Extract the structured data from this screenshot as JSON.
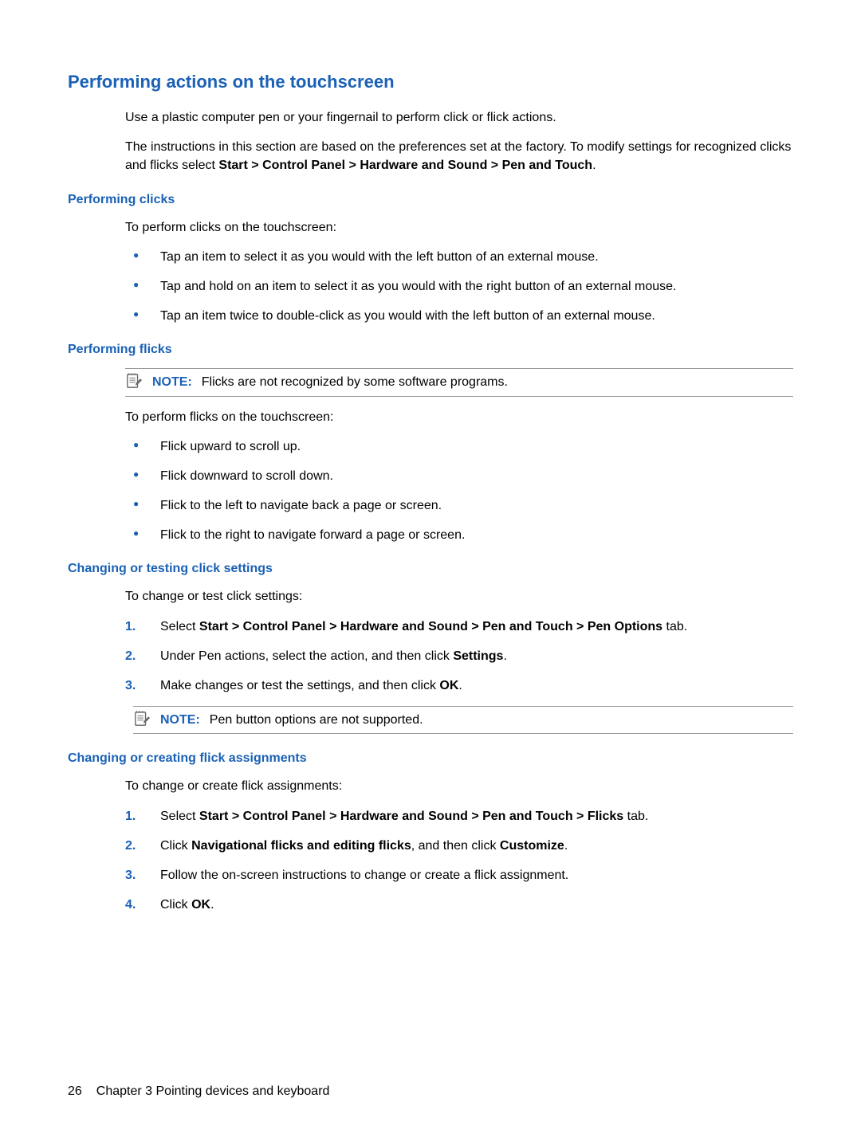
{
  "h1": "Performing actions on the touchscreen",
  "intro": {
    "p1": "Use a plastic computer pen or your fingernail to perform click or flick actions.",
    "p2_pre": "The instructions in this section are based on the preferences set at the factory. To modify settings for recognized clicks and flicks select ",
    "p2_bold": "Start > Control Panel > Hardware and Sound > Pen and Touch",
    "p2_post": "."
  },
  "sec_clicks": {
    "heading": "Performing clicks",
    "lead": "To perform clicks on the touchscreen:",
    "items": [
      "Tap an item to select it as you would with the left button of an external mouse.",
      "Tap and hold on an item to select it as you would with the right button of an external mouse.",
      "Tap an item twice to double-click as you would with the left button of an external mouse."
    ]
  },
  "sec_flicks": {
    "heading": "Performing flicks",
    "note_label": "NOTE:",
    "note_text": "Flicks are not recognized by some software programs.",
    "lead": "To perform flicks on the touchscreen:",
    "items": [
      "Flick upward to scroll up.",
      "Flick downward to scroll down.",
      "Flick to the left to navigate back a page or screen.",
      "Flick to the right to navigate forward a page or screen."
    ]
  },
  "sec_click_settings": {
    "heading": "Changing or testing click settings",
    "lead": "To change or test click settings:",
    "step1_pre": "Select ",
    "step1_bold": "Start > Control Panel > Hardware and Sound > Pen and Touch > Pen Options",
    "step1_post": " tab.",
    "step2_pre": "Under Pen actions, select the action, and then click ",
    "step2_bold": "Settings",
    "step2_post": ".",
    "step3_pre": "Make changes or test the settings, and then click ",
    "step3_bold": "OK",
    "step3_post": ".",
    "note_label": "NOTE:",
    "note_text": "Pen button options are not supported."
  },
  "sec_flick_assign": {
    "heading": "Changing or creating flick assignments",
    "lead": "To change or create flick assignments:",
    "step1_pre": "Select ",
    "step1_bold": "Start > Control Panel > Hardware and Sound > Pen and Touch > Flicks",
    "step1_post": " tab.",
    "step2_pre": "Click ",
    "step2_bold1": "Navigational flicks and editing flicks",
    "step2_mid": ", and then click ",
    "step2_bold2": "Customize",
    "step2_post": ".",
    "step3": "Follow the on-screen instructions to change or create a flick assignment.",
    "step4_pre": "Click ",
    "step4_bold": "OK",
    "step4_post": "."
  },
  "footer": {
    "page_number": "26",
    "chapter": "Chapter 3   Pointing devices and keyboard"
  }
}
